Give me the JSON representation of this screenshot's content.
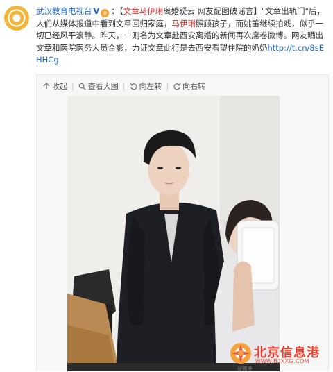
{
  "post": {
    "author": "武汉教育电视台",
    "verified_mark": "V",
    "badge_glyph": "e",
    "text_pre": "：【",
    "text_highlight1": "文章马伊琍",
    "text_mid1": "离婚疑云 网友配图破谣言】\"文章出轨门\"后，人们从媒体报道中看到文章回归家庭，",
    "text_highlight2": "马伊琍",
    "text_mid2": "照顾孩子，而姚笛继续拍戏，似乎一切已经风平浪静。昨天，一则名为文章赴西安离婚的新闻再次席卷微博。网友晒出文章和医院医务人员合影，力证文章此行是去西安看望住院的奶奶",
    "link": "http://t.cn/8sEHHCg"
  },
  "toolbar": {
    "collect": "收起",
    "view_large": "查看大图",
    "rotate_left": "向左转",
    "rotate_right": "向右转"
  },
  "watermark": {
    "title": "北京信息港",
    "url": "WWW.BJXXG.COM",
    "weibo": "@微博"
  },
  "colors": {
    "link": "#1f6bc7",
    "highlight": "#d02b2b",
    "watermark": "#e8402f"
  }
}
